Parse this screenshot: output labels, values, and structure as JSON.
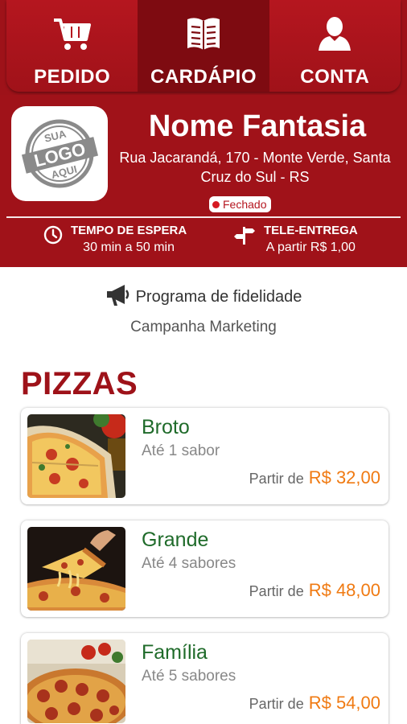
{
  "nav": {
    "tabs": [
      {
        "label": "PEDIDO",
        "icon": "cart-icon"
      },
      {
        "label": "CARDÁPIO",
        "icon": "menu-book-icon",
        "active": true
      },
      {
        "label": "CONTA",
        "icon": "user-icon"
      }
    ]
  },
  "store": {
    "name": "Nome Fantasia",
    "address": "Rua Jacarandá, 170 - Monte Verde, Santa Cruz do Sul - RS",
    "logo": {
      "top": "SUA",
      "main": "LOGO",
      "bottom": "AQUI"
    },
    "status": "Fechado",
    "wait": {
      "title": "TEMPO DE ESPERA",
      "value": "30 min a 50 min"
    },
    "delivery": {
      "title": "TELE-ENTREGA",
      "value": "A partir R$ 1,00"
    }
  },
  "loyalty": {
    "label": "Programa de fidelidade",
    "campaign": "Campanha Marketing"
  },
  "section": {
    "title": "PIZZAS"
  },
  "items": [
    {
      "name": "Broto",
      "subtitle": "Até 1 sabor",
      "price_prefix": "Partir de",
      "price": "R$ 32,00"
    },
    {
      "name": "Grande",
      "subtitle": "Até 4 sabores",
      "price_prefix": "Partir de",
      "price": "R$ 48,00"
    },
    {
      "name": "Família",
      "subtitle": "Até 5 sabores",
      "price_prefix": "Partir de",
      "price": "R$ 54,00"
    }
  ],
  "colors": {
    "brand_red": "#a01219",
    "accent_orange": "#f07a12",
    "item_green": "#1f6b2a"
  }
}
